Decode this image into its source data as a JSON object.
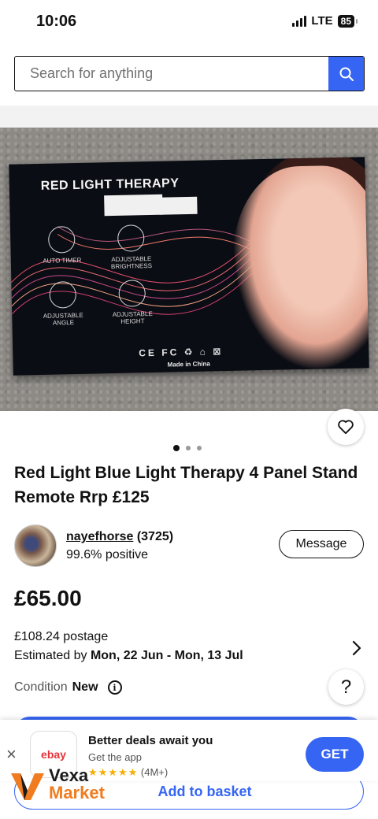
{
  "status_bar": {
    "time": "10:06",
    "network": "LTE",
    "battery": "85"
  },
  "search": {
    "placeholder": "Search for anything"
  },
  "product_image": {
    "box_title": "RED LIGHT THERAPY",
    "features": [
      "AUTO TIMER",
      "ADJUSTABLE BRIGHTNESS",
      "ADJUSTABLE ANGLE",
      "ADJUSTABLE HEIGHT"
    ],
    "certs": "CE FC ♻ ⌂ ⊠",
    "made_in": "Made in China",
    "slide_count": 3,
    "active_slide": 1
  },
  "listing": {
    "title": "Red Light Blue Light Therapy 4 Panel Stand Remote Rrp £125",
    "seller": {
      "username": "nayefhorse",
      "feedback_count": "(3725)",
      "positive": "99.6% positive"
    },
    "message_label": "Message",
    "price": "£65.00",
    "postage": "£108.24 postage",
    "estimate_prefix": "Estimated by ",
    "estimate_dates": "Mon, 22 Jun - Mon, 13 Jul",
    "condition_label": "Condition",
    "condition_value": "New"
  },
  "help_label": "?",
  "basket_label": "Add to basket",
  "app_banner": {
    "close": "×",
    "app_name": "ebay",
    "title": "Better deals await you",
    "subtitle": "Get the app",
    "stars": "★★★★★",
    "rating_count": "(4M+)",
    "get_label": "GET"
  },
  "watermark": {
    "line1": "Vexa",
    "line2": "Market"
  },
  "colors": {
    "accent": "#3665f3",
    "watermark_orange": "#f07c1f"
  }
}
